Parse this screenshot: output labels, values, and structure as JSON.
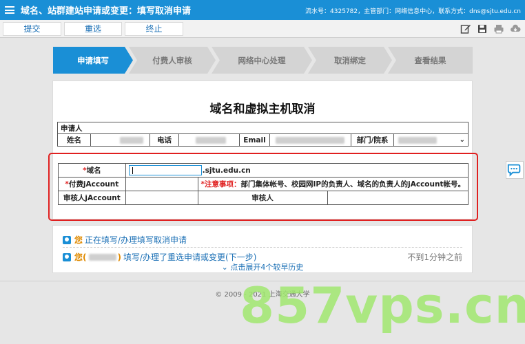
{
  "titlebar": {
    "title": "域名、站群建站申请或变更：填写取消申请",
    "meta": "流水号：4325782，主管部门：网络信息中心，联系方式：dns@sjtu.edu.cn"
  },
  "toolbar": {
    "buttons": [
      "提交",
      "重选",
      "终止"
    ],
    "icons": [
      "edit-icon",
      "save-icon",
      "print-icon",
      "cloud-download-icon"
    ]
  },
  "steps": [
    "申请填写",
    "付费人审核",
    "网络中心处理",
    "取消绑定",
    "查看结果"
  ],
  "active_step": 0,
  "form": {
    "title": "域名和虚拟主机取消",
    "applicant_section": "申请人",
    "name_label": "姓名",
    "phone_label": "电话",
    "email_label": "Email",
    "dept_label": "部门/院系",
    "domain_label": "域名",
    "domain_value": "",
    "domain_suffix": ".sjtu.edu.cn",
    "payer_label": "付费jAccount",
    "payer_value": "",
    "note_label": "*注意事项：",
    "note_text": "部门集体帐号、校园网IP的负责人、域名的负责人的jAccount帐号。",
    "reviewer_account_label": "审核人jAccount",
    "reviewer_label": "审核人",
    "required_mark": "*"
  },
  "history": {
    "row1_you": "您",
    "row1_text": "正在填写/办理填写取消申请",
    "row2_you": "您(",
    "row2_close": ")",
    "row2_text": "填写/办理了重选申请或变更(下一步)",
    "row2_time": "不到1分钟之前",
    "expand": "点击展开4个较早历史"
  },
  "footer": "©  2009 - 2021  上海交通大学",
  "watermark": "857vps.cn",
  "colors": {
    "primary": "#1a8fd6",
    "danger": "#e02020",
    "accent": "#e08a00"
  }
}
